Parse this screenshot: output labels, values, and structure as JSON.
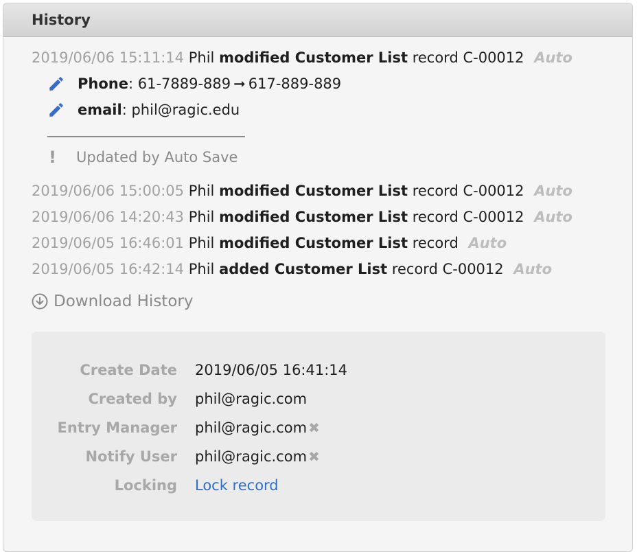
{
  "header": {
    "title": "History"
  },
  "history": [
    {
      "timestamp": "2019/06/06 15:11:14",
      "user": "Phil",
      "action": "modified Customer List",
      "pre": "record",
      "record": "C-00012",
      "tag": "Auto"
    },
    {
      "timestamp": "2019/06/06 15:00:05",
      "user": "Phil",
      "action": "modified Customer List",
      "pre": "record",
      "record": "C-00012",
      "tag": "Auto"
    },
    {
      "timestamp": "2019/06/06 14:20:43",
      "user": "Phil",
      "action": "modified Customer List",
      "pre": "record",
      "record": "C-00012",
      "tag": "Auto"
    },
    {
      "timestamp": "2019/06/05 16:46:01",
      "user": "Phil",
      "action": "modified Customer List",
      "pre": "record",
      "record": "",
      "tag": "Auto"
    },
    {
      "timestamp": "2019/06/05 16:42:14",
      "user": "Phil",
      "action": "added Customer List",
      "pre": "record",
      "record": "C-00012",
      "tag": "Auto"
    }
  ],
  "changes": [
    {
      "field": "Phone",
      "old": "61-7889-889",
      "arrow": "➞",
      "new": "617-889-889"
    },
    {
      "field": "email",
      "value": "phil@ragic.edu"
    }
  ],
  "auto_note": {
    "icon": "!",
    "text": "Updated by Auto Save"
  },
  "download": {
    "label": "Download History",
    "icon": "download-circle-icon"
  },
  "info": {
    "create_date": {
      "label": "Create Date",
      "value": "2019/06/05 16:41:14"
    },
    "created_by": {
      "label": "Created by",
      "value": "phil@ragic.com"
    },
    "entry_manager": {
      "label": "Entry Manager",
      "value": "phil@ragic.com",
      "remove": "✖"
    },
    "notify_user": {
      "label": "Notify User",
      "value": "phil@ragic.com",
      "remove": "✖"
    },
    "locking": {
      "label": "Locking",
      "value": "Lock record"
    }
  },
  "colors": {
    "link": "#2f6fc4",
    "pencil": "#3a6cc6",
    "muted": "#a2a2a2"
  }
}
